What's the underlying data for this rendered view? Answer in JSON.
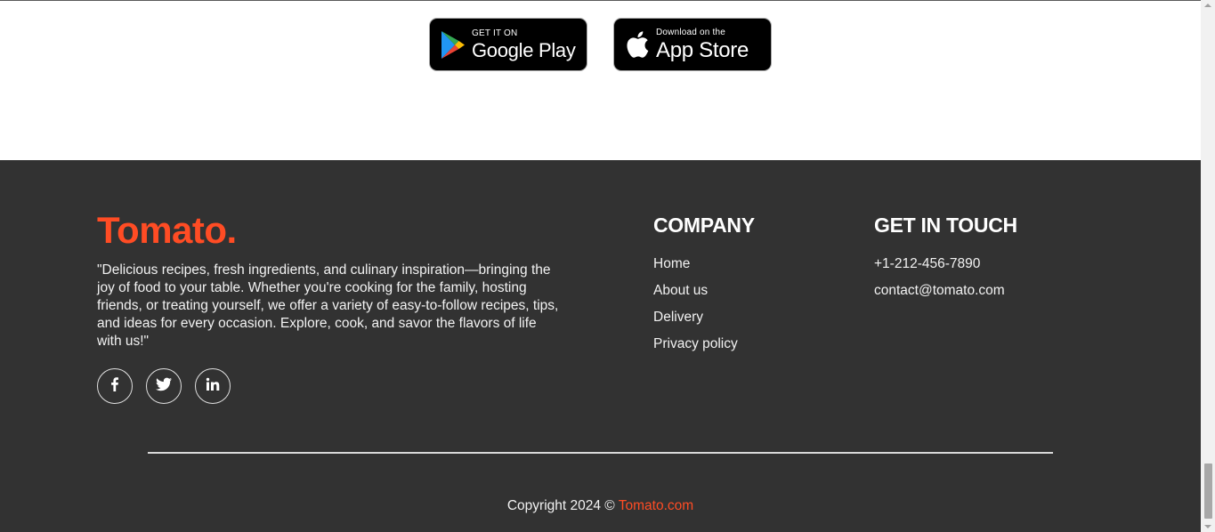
{
  "badges": {
    "google_play": {
      "small": "GET IT ON",
      "big": "Google Play"
    },
    "app_store": {
      "small": "Download on the",
      "big": "App Store"
    }
  },
  "footer": {
    "logo": "Tomato.",
    "about": "\"Delicious recipes, fresh ingredients, and culinary inspiration—bringing the joy of food to your table. Whether you're cooking for the family, hosting friends, or treating yourself, we offer a variety of easy-to-follow recipes, tips, and ideas for every occasion. Explore, cook, and savor the flavors of life with us!\"",
    "socials": [
      "facebook-icon",
      "twitter-icon",
      "linkedin-icon"
    ],
    "company": {
      "title": "COMPANY",
      "links": [
        "Home",
        "About us",
        "Delivery",
        "Privacy policy"
      ]
    },
    "contact": {
      "title": "GET IN TOUCH",
      "phone": "+1-212-456-7890",
      "email": "contact@tomato.com"
    },
    "copyright_prefix": "Copyright 2024 © ",
    "copyright_brand": "Tomato.com"
  },
  "colors": {
    "accent": "#ff4c24",
    "footer_bg": "#323232"
  }
}
